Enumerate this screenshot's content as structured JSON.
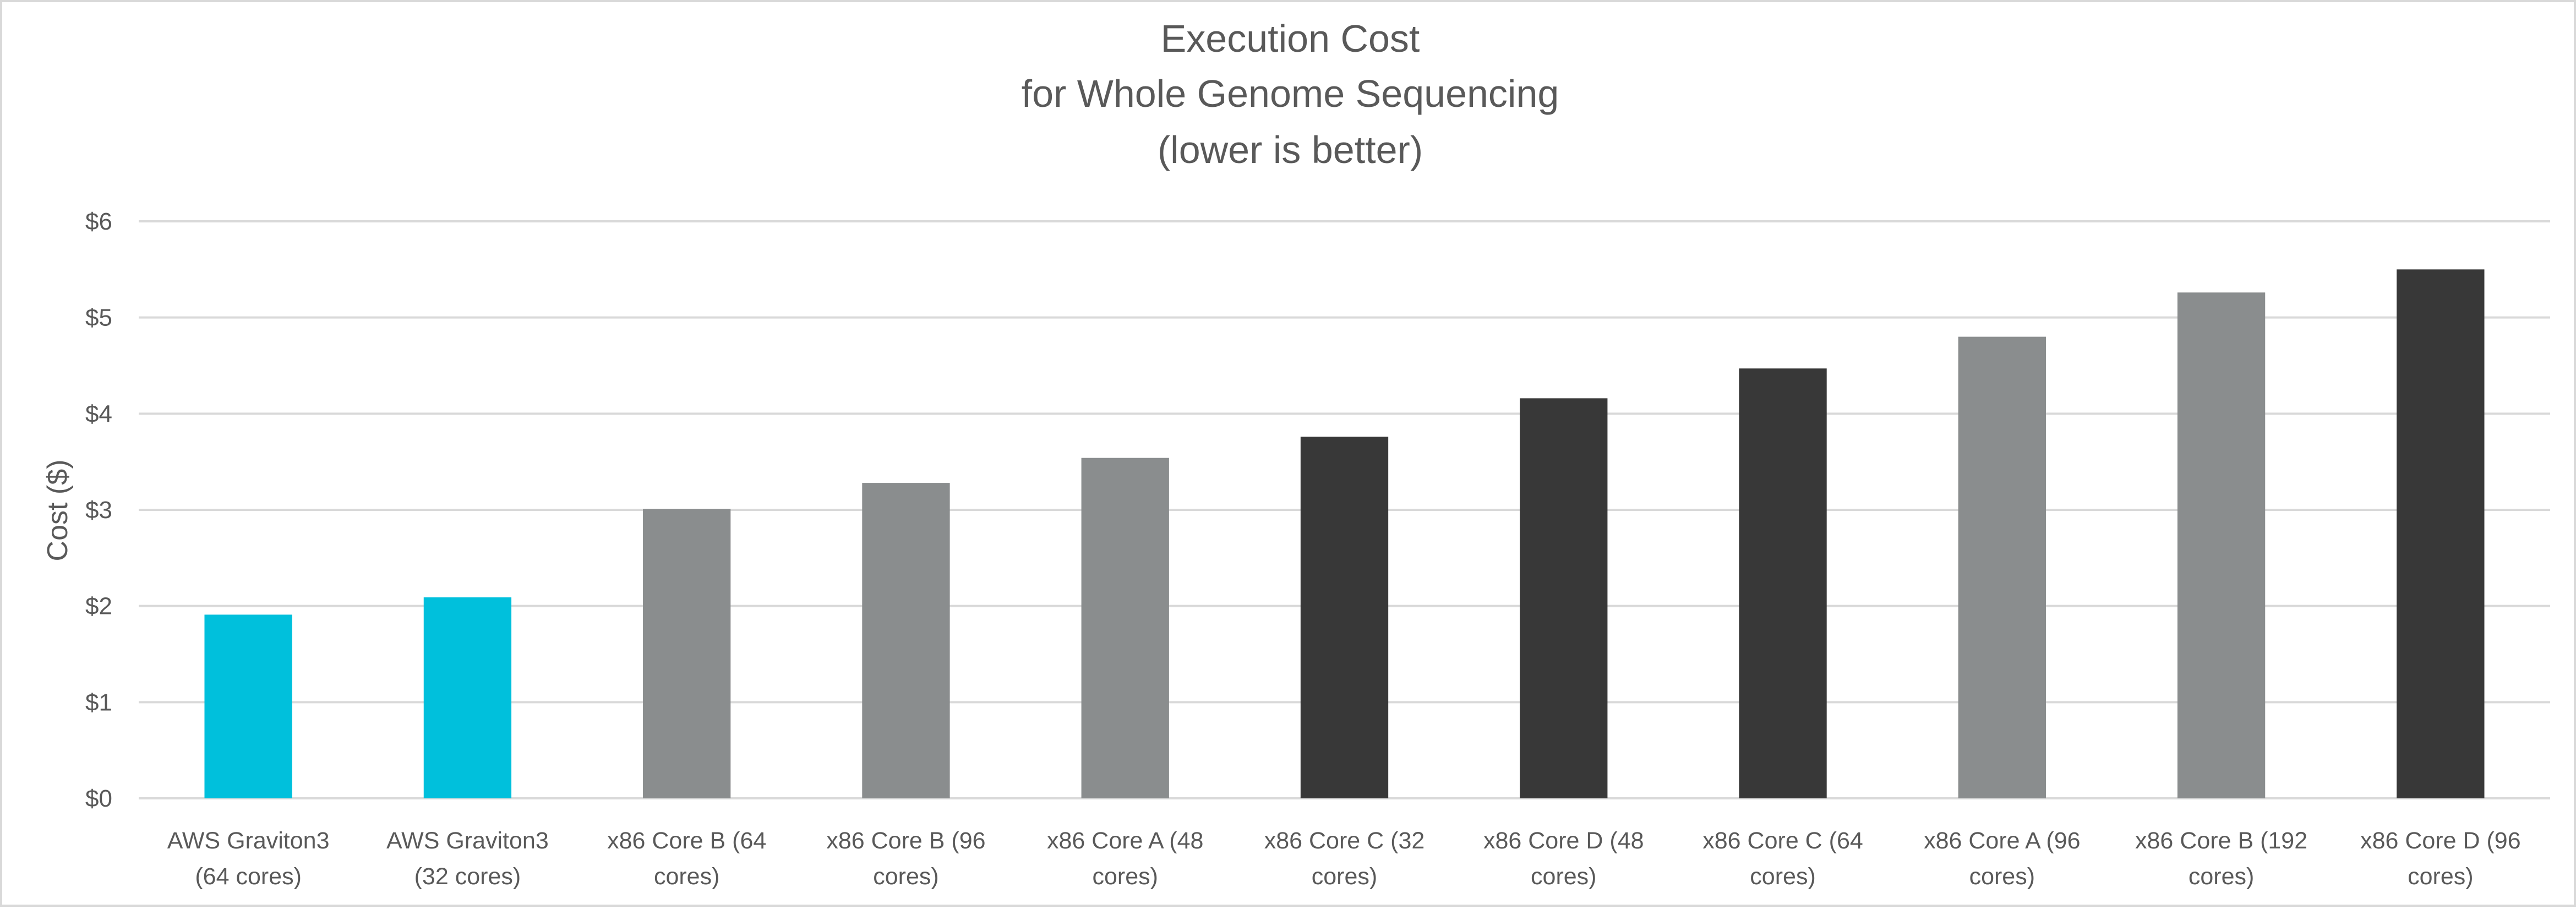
{
  "chart_data": {
    "type": "bar",
    "title": "Execution Cost",
    "title_lines": [
      "Execution Cost",
      "for Whole Genome Sequencing",
      "(lower is better)"
    ],
    "xlabel": "",
    "ylabel": "Cost ($)",
    "ylim": [
      0,
      6
    ],
    "yticks": [
      0,
      1,
      2,
      3,
      4,
      5,
      6
    ],
    "ytick_labels": [
      "$0",
      "$1",
      "$2",
      "$3",
      "$4",
      "$5",
      "$6"
    ],
    "grid": true,
    "legend": "none",
    "categories": [
      "AWS Graviton3 (64 cores)",
      "AWS Graviton3 (32 cores)",
      "x86 Core B (64 cores)",
      "x86 Core B (96 cores)",
      "x86 Core A (48 cores)",
      "x86 Core C (32 cores)",
      "x86 Core D (48 cores)",
      "x86 Core C (64 cores)",
      "x86 Core A (96 cores)",
      "x86 Core B (192 cores)",
      "x86 Core D (96 cores)"
    ],
    "category_label_lines": [
      [
        "AWS Graviton3",
        "(64 cores)"
      ],
      [
        "AWS Graviton3",
        "(32 cores)"
      ],
      [
        "x86 Core B (64",
        "cores)"
      ],
      [
        "x86 Core B (96",
        "cores)"
      ],
      [
        "x86 Core A (48",
        "cores)"
      ],
      [
        "x86 Core C (32",
        "cores)"
      ],
      [
        "x86 Core D (48",
        "cores)"
      ],
      [
        "x86 Core C (64",
        "cores)"
      ],
      [
        "x86 Core A (96",
        "cores)"
      ],
      [
        "x86 Core B (192",
        "cores)"
      ],
      [
        "x86 Core D (96",
        "cores)"
      ]
    ],
    "values": [
      1.91,
      2.09,
      3.01,
      3.28,
      3.54,
      3.76,
      4.16,
      4.47,
      4.8,
      5.26,
      5.5
    ],
    "bar_colors": [
      "#00C0DC",
      "#00C0DC",
      "#8A8D8E",
      "#8A8D8E",
      "#8A8D8E",
      "#383838",
      "#383838",
      "#383838",
      "#8A8D8E",
      "#8A8D8E",
      "#383838"
    ]
  },
  "colors": {
    "graviton": "#00C0DC",
    "x86_gray": "#8A8D8E",
    "x86_dark": "#383838",
    "text": "#595959",
    "grid": "#D9D9D9"
  }
}
